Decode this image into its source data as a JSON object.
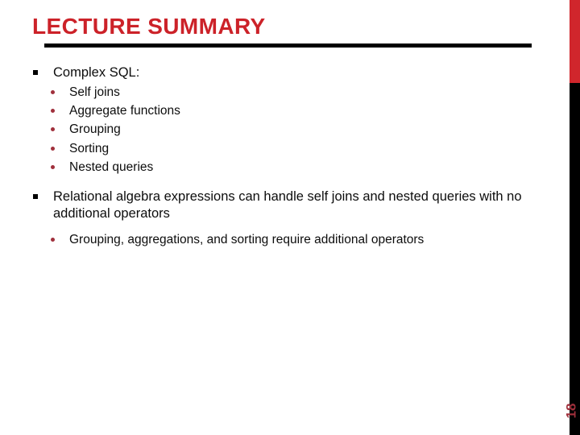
{
  "slide": {
    "title": "LECTURE SUMMARY",
    "page_number": "18",
    "colors": {
      "title_red": "#cc2229",
      "edge_red": "#d0262c",
      "edge_black": "#000000",
      "rule_black": "#000000",
      "sub_bullet_red": "#a0303c",
      "body_text": "#0d0d0d",
      "background": "#ffffff"
    },
    "content": [
      {
        "level": 1,
        "marker": "square-bullet-icon",
        "text": "Complex SQL:"
      },
      {
        "level": 2,
        "marker": "round-bullet-icon",
        "text": "Self joins"
      },
      {
        "level": 2,
        "marker": "round-bullet-icon",
        "text": "Aggregate functions"
      },
      {
        "level": 2,
        "marker": "round-bullet-icon",
        "text": "Grouping"
      },
      {
        "level": 2,
        "marker": "round-bullet-icon",
        "text": "Sorting"
      },
      {
        "level": 2,
        "marker": "round-bullet-icon",
        "text": "Nested queries"
      },
      {
        "level": 1,
        "marker": "square-bullet-icon",
        "text": "Relational algebra expressions can handle self joins and nested queries with no additional operators"
      },
      {
        "level": 2,
        "marker": "round-bullet-icon",
        "text": "Grouping, aggregations, and sorting require additional operators"
      }
    ]
  }
}
